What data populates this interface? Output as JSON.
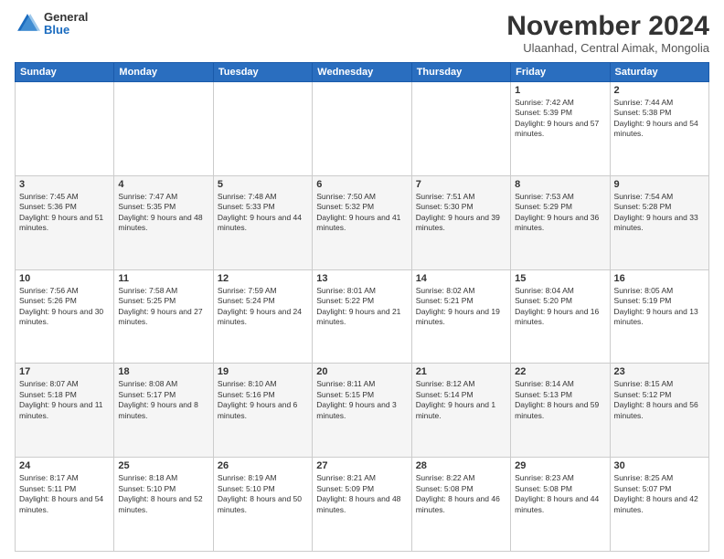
{
  "header": {
    "logo": {
      "general": "General",
      "blue": "Blue"
    },
    "title": "November 2024",
    "subtitle": "Ulaanhad, Central Aimak, Mongolia"
  },
  "weekdays": [
    "Sunday",
    "Monday",
    "Tuesday",
    "Wednesday",
    "Thursday",
    "Friday",
    "Saturday"
  ],
  "weeks": [
    [
      {
        "day": "",
        "info": ""
      },
      {
        "day": "",
        "info": ""
      },
      {
        "day": "",
        "info": ""
      },
      {
        "day": "",
        "info": ""
      },
      {
        "day": "",
        "info": ""
      },
      {
        "day": "1",
        "info": "Sunrise: 7:42 AM\nSunset: 5:39 PM\nDaylight: 9 hours and 57 minutes."
      },
      {
        "day": "2",
        "info": "Sunrise: 7:44 AM\nSunset: 5:38 PM\nDaylight: 9 hours and 54 minutes."
      }
    ],
    [
      {
        "day": "3",
        "info": "Sunrise: 7:45 AM\nSunset: 5:36 PM\nDaylight: 9 hours and 51 minutes."
      },
      {
        "day": "4",
        "info": "Sunrise: 7:47 AM\nSunset: 5:35 PM\nDaylight: 9 hours and 48 minutes."
      },
      {
        "day": "5",
        "info": "Sunrise: 7:48 AM\nSunset: 5:33 PM\nDaylight: 9 hours and 44 minutes."
      },
      {
        "day": "6",
        "info": "Sunrise: 7:50 AM\nSunset: 5:32 PM\nDaylight: 9 hours and 41 minutes."
      },
      {
        "day": "7",
        "info": "Sunrise: 7:51 AM\nSunset: 5:30 PM\nDaylight: 9 hours and 39 minutes."
      },
      {
        "day": "8",
        "info": "Sunrise: 7:53 AM\nSunset: 5:29 PM\nDaylight: 9 hours and 36 minutes."
      },
      {
        "day": "9",
        "info": "Sunrise: 7:54 AM\nSunset: 5:28 PM\nDaylight: 9 hours and 33 minutes."
      }
    ],
    [
      {
        "day": "10",
        "info": "Sunrise: 7:56 AM\nSunset: 5:26 PM\nDaylight: 9 hours and 30 minutes."
      },
      {
        "day": "11",
        "info": "Sunrise: 7:58 AM\nSunset: 5:25 PM\nDaylight: 9 hours and 27 minutes."
      },
      {
        "day": "12",
        "info": "Sunrise: 7:59 AM\nSunset: 5:24 PM\nDaylight: 9 hours and 24 minutes."
      },
      {
        "day": "13",
        "info": "Sunrise: 8:01 AM\nSunset: 5:22 PM\nDaylight: 9 hours and 21 minutes."
      },
      {
        "day": "14",
        "info": "Sunrise: 8:02 AM\nSunset: 5:21 PM\nDaylight: 9 hours and 19 minutes."
      },
      {
        "day": "15",
        "info": "Sunrise: 8:04 AM\nSunset: 5:20 PM\nDaylight: 9 hours and 16 minutes."
      },
      {
        "day": "16",
        "info": "Sunrise: 8:05 AM\nSunset: 5:19 PM\nDaylight: 9 hours and 13 minutes."
      }
    ],
    [
      {
        "day": "17",
        "info": "Sunrise: 8:07 AM\nSunset: 5:18 PM\nDaylight: 9 hours and 11 minutes."
      },
      {
        "day": "18",
        "info": "Sunrise: 8:08 AM\nSunset: 5:17 PM\nDaylight: 9 hours and 8 minutes."
      },
      {
        "day": "19",
        "info": "Sunrise: 8:10 AM\nSunset: 5:16 PM\nDaylight: 9 hours and 6 minutes."
      },
      {
        "day": "20",
        "info": "Sunrise: 8:11 AM\nSunset: 5:15 PM\nDaylight: 9 hours and 3 minutes."
      },
      {
        "day": "21",
        "info": "Sunrise: 8:12 AM\nSunset: 5:14 PM\nDaylight: 9 hours and 1 minute."
      },
      {
        "day": "22",
        "info": "Sunrise: 8:14 AM\nSunset: 5:13 PM\nDaylight: 8 hours and 59 minutes."
      },
      {
        "day": "23",
        "info": "Sunrise: 8:15 AM\nSunset: 5:12 PM\nDaylight: 8 hours and 56 minutes."
      }
    ],
    [
      {
        "day": "24",
        "info": "Sunrise: 8:17 AM\nSunset: 5:11 PM\nDaylight: 8 hours and 54 minutes."
      },
      {
        "day": "25",
        "info": "Sunrise: 8:18 AM\nSunset: 5:10 PM\nDaylight: 8 hours and 52 minutes."
      },
      {
        "day": "26",
        "info": "Sunrise: 8:19 AM\nSunset: 5:10 PM\nDaylight: 8 hours and 50 minutes."
      },
      {
        "day": "27",
        "info": "Sunrise: 8:21 AM\nSunset: 5:09 PM\nDaylight: 8 hours and 48 minutes."
      },
      {
        "day": "28",
        "info": "Sunrise: 8:22 AM\nSunset: 5:08 PM\nDaylight: 8 hours and 46 minutes."
      },
      {
        "day": "29",
        "info": "Sunrise: 8:23 AM\nSunset: 5:08 PM\nDaylight: 8 hours and 44 minutes."
      },
      {
        "day": "30",
        "info": "Sunrise: 8:25 AM\nSunset: 5:07 PM\nDaylight: 8 hours and 42 minutes."
      }
    ]
  ]
}
